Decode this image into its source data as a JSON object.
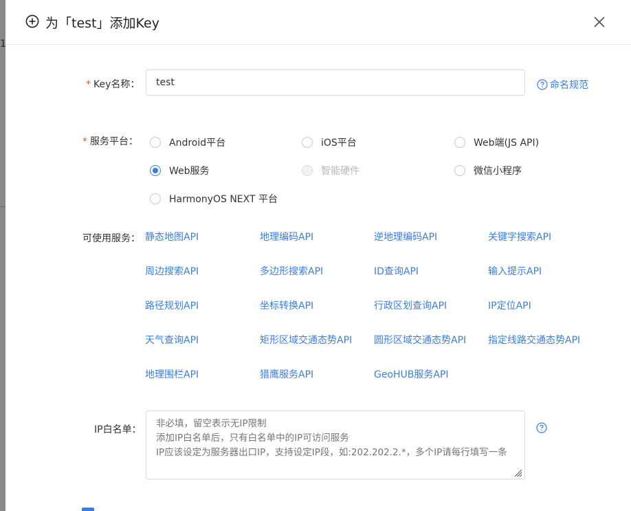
{
  "backdrop": {
    "edge_digit": "1"
  },
  "dialog": {
    "title": "为「test」添加Key",
    "header_icon": "plus-circle-icon",
    "close_icon": "close-icon"
  },
  "key_name": {
    "label": "Key名称：",
    "required_mark": "*",
    "value": "test",
    "help_link": "命名规范",
    "help_icon": "question-circle-icon"
  },
  "platform": {
    "label": "服务平台：",
    "required_mark": "*",
    "options": [
      {
        "label": "Android平台",
        "checked": false,
        "disabled": false
      },
      {
        "label": "iOS平台",
        "checked": false,
        "disabled": false
      },
      {
        "label": "Web端(JS API)",
        "checked": false,
        "disabled": false
      },
      {
        "label": "Web服务",
        "checked": true,
        "disabled": false
      },
      {
        "label": "智能硬件",
        "checked": false,
        "disabled": true
      },
      {
        "label": "微信小程序",
        "checked": false,
        "disabled": false
      },
      {
        "label": "HarmonyOS NEXT 平台",
        "checked": false,
        "disabled": false
      }
    ]
  },
  "services": {
    "label": "可使用服务：",
    "items": [
      "静态地图API",
      "地理编码API",
      "逆地理编码API",
      "关键字搜索API",
      "周边搜索API",
      "多边形搜索API",
      "ID查询API",
      "输入提示API",
      "路径规划API",
      "坐标转换API",
      "行政区划查询API",
      "IP定位API",
      "天气查询API",
      "矩形区域交通态势API",
      "圆形区域交通态势API",
      "指定线路交通态势API",
      "地理围栏API",
      "猎鹰服务API",
      "GeoHUB服务API"
    ]
  },
  "ip_whitelist": {
    "label": "IP白名单：",
    "placeholder": "非必填，留空表示无IP限制\n添加IP白名单后，只有白名单中的IP可访问服务\nIP应该设定为服务器出口IP，支持设定IP段，如:202.202.2.*，多个IP请每行填写一条",
    "help_icon": "question-circle-icon"
  },
  "colors": {
    "accent": "#3a7ee0",
    "required": "#f0552f",
    "disabled": "#b8b8b8",
    "backdrop": "#7a7a7a"
  }
}
